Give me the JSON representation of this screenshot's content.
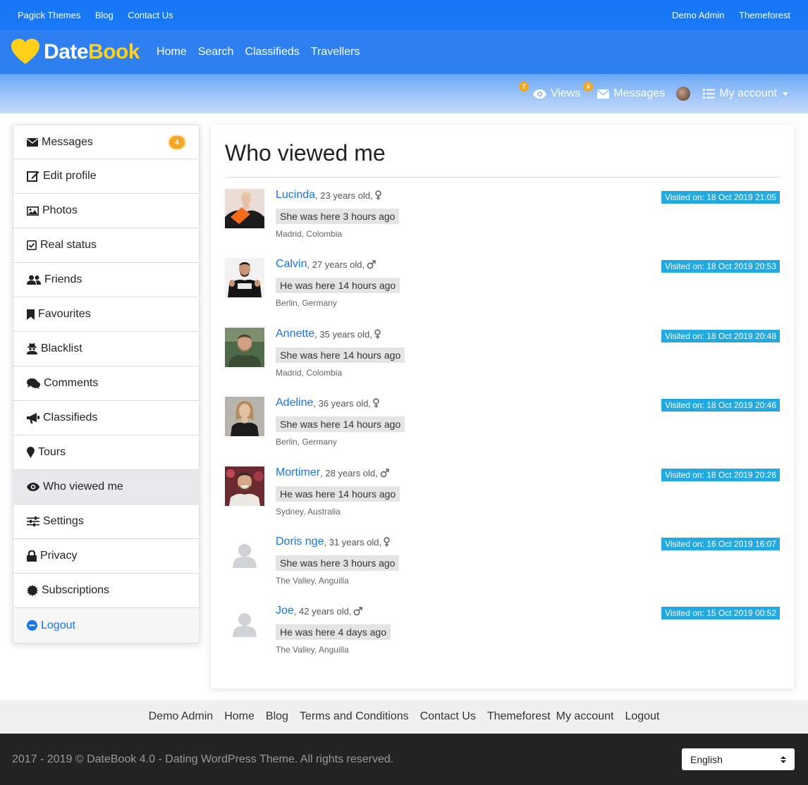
{
  "topbar": {
    "left": [
      "Pagick Themes",
      "Blog",
      "Contact Us"
    ],
    "right": [
      "Demo Admin",
      "Themeforest"
    ]
  },
  "brand": {
    "part1": "Date",
    "part2": "Book"
  },
  "mainnav": [
    "Home",
    "Search",
    "Classifieds",
    "Travellers"
  ],
  "subbar": {
    "views_label": "Views",
    "views_count": "7",
    "messages_label": "Messages",
    "messages_count": "4",
    "account_label": "My account"
  },
  "sidebar": {
    "messages_badge": "4",
    "items": [
      {
        "label": "Messages",
        "icon": "envelope-icon"
      },
      {
        "label": "Edit profile",
        "icon": "edit-icon"
      },
      {
        "label": "Photos",
        "icon": "image-icon"
      },
      {
        "label": "Real status",
        "icon": "check-square-icon"
      },
      {
        "label": "Friends",
        "icon": "users-icon"
      },
      {
        "label": "Favourites",
        "icon": "bookmark-icon"
      },
      {
        "label": "Blacklist",
        "icon": "user-secret-icon"
      },
      {
        "label": "Comments",
        "icon": "comments-icon"
      },
      {
        "label": "Classifieds",
        "icon": "bullhorn-icon"
      },
      {
        "label": "Tours",
        "icon": "map-marker-icon"
      },
      {
        "label": "Who viewed me",
        "icon": "eye-icon"
      },
      {
        "label": "Settings",
        "icon": "sliders-icon"
      },
      {
        "label": "Privacy",
        "icon": "lock-icon"
      },
      {
        "label": "Subscriptions",
        "icon": "certificate-icon"
      },
      {
        "label": "Logout",
        "icon": "minus-circle-icon"
      }
    ]
  },
  "main": {
    "title": "Who viewed me",
    "entries": [
      {
        "name": "Lucinda",
        "age": ", 23 years old,",
        "gender": "female",
        "ago": "She was here 3 hours ago",
        "location": "Madrid, Colombia",
        "visited": "Visited on: 18 Oct 2019 21:05"
      },
      {
        "name": "Calvin",
        "age": ", 27 years old,",
        "gender": "male",
        "ago": "He was here 14 hours ago",
        "location": "Berlin, Germany",
        "visited": "Visited on: 18 Oct 2019 20:53"
      },
      {
        "name": "Annette",
        "age": ", 35 years old,",
        "gender": "female",
        "ago": "She was here 14 hours ago",
        "location": "Madrid, Colombia",
        "visited": "Visited on: 18 Oct 2019 20:48"
      },
      {
        "name": "Adeline",
        "age": ", 36 years old,",
        "gender": "female",
        "ago": "She was here 14 hours ago",
        "location": "Berlin, Germany",
        "visited": "Visited on: 18 Oct 2019 20:46"
      },
      {
        "name": "Mortimer",
        "age": ", 28 years old,",
        "gender": "male",
        "ago": "He was here 14 hours ago",
        "location": "Sydney, Australia",
        "visited": "Visited on: 18 Oct 2019 20:26"
      },
      {
        "name": "Doris nge",
        "age": ", 31 years old,",
        "gender": "female",
        "ago": "She was here 3 hours ago",
        "location": "The Valley, Anguilla",
        "visited": "Visited on: 16 Oct 2019 16:07"
      },
      {
        "name": "Joe",
        "age": ", 42 years old,",
        "gender": "male",
        "ago": "He was here 4 days ago",
        "location": "The Valley, Anguilla",
        "visited": "Visited on: 15 Oct 2019 00:52"
      }
    ]
  },
  "footnav": [
    "Demo Admin",
    "Home",
    "Blog",
    "Terms and Conditions",
    "Contact Us",
    "Themeforest",
    "My account",
    "Logout"
  ],
  "bottombar": {
    "copyright": "2017 - 2019 © DateBook 4.0 - Dating WordPress Theme. All rights reserved.",
    "language": "English"
  },
  "colors": {
    "primary": "#1a76f4",
    "accent": "#ffd11a",
    "badge": "#f5a623",
    "visited": "#22a9e0",
    "link": "#1a73e8"
  }
}
